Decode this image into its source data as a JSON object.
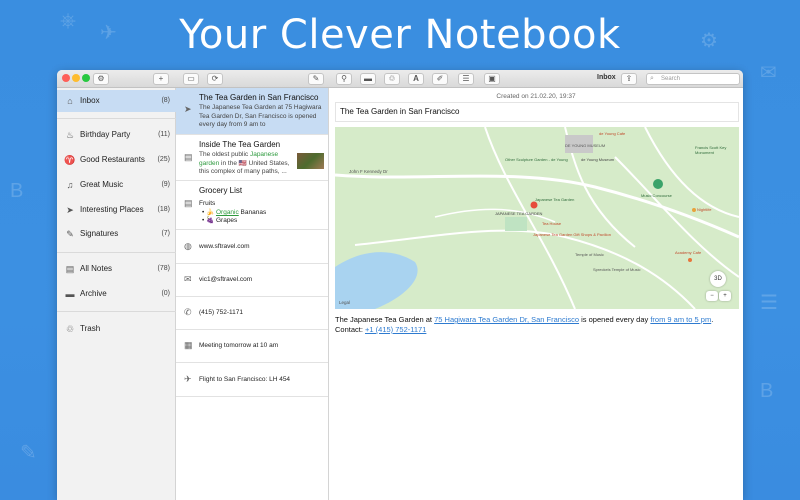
{
  "hero": {
    "title": "Your Clever Notebook"
  },
  "toolbar": {
    "window_title": "Inbox",
    "search_placeholder": "Search",
    "add_label": "+",
    "settings_icon": "gear-icon"
  },
  "sidebar": {
    "items": [
      {
        "label": "Inbox",
        "count": "(8)",
        "icon": "inbox-icon",
        "glyph": "⌂"
      },
      {
        "label": "Birthday Party",
        "count": "(11)",
        "icon": "cake-icon",
        "glyph": "♨"
      },
      {
        "label": "Good Restaurants",
        "count": "(25)",
        "icon": "fork-knife-icon",
        "glyph": "♈"
      },
      {
        "label": "Great Music",
        "count": "(9)",
        "icon": "music-note-icon",
        "glyph": "♫"
      },
      {
        "label": "Interesting Places",
        "count": "(18)",
        "icon": "location-arrow-icon",
        "glyph": "➤"
      },
      {
        "label": "Signatures",
        "count": "(7)",
        "icon": "pen-icon",
        "glyph": "✎"
      },
      {
        "label": "All Notes",
        "count": "(78)",
        "icon": "document-icon",
        "glyph": "▤"
      },
      {
        "label": "Archive",
        "count": "(0)",
        "icon": "archive-box-icon",
        "glyph": "▬"
      },
      {
        "label": "Trash",
        "count": "",
        "icon": "trash-icon",
        "glyph": "♲"
      }
    ]
  },
  "notes": {
    "n1": {
      "title": "The Tea Garden in San Francisco",
      "preview": "The Japanese Tea Garden at 75 Hagiwara Tea Garden Dr, San Francisco is opened every day from 9 am to"
    },
    "n2": {
      "title": "Inside The Tea Garden",
      "preview_a": "The oldest public ",
      "preview_hl": "Japanese garden",
      "preview_b": " in the 🇺🇸 United States, this complex of many paths, ..."
    },
    "n3": {
      "title": "Grocery List",
      "line1": "Fruits",
      "line2_prefix": "• 🍌 ",
      "line2_hl": "Organic",
      "line2_rest": " Bananas",
      "line3": "• 🍇 Grapes"
    },
    "n4": {
      "text": "www.sftravel.com"
    },
    "n5": {
      "text": "vic1@sftravel.com"
    },
    "n6": {
      "text": "(415) 752-1171"
    },
    "n7": {
      "text": "Meeting tomorrow at 10 am"
    },
    "n8": {
      "text": "Flight to San Francisco: LH 454"
    }
  },
  "editor": {
    "created": "Created on 21.02.20, 19:37",
    "title": "The Tea Garden in San Francisco",
    "body_1": "The Japanese Tea Garden at ",
    "link_address": "75 Hagiwara Tea Garden Dr, San Francisco",
    "body_2": " is opened every day ",
    "link_hours": "from 9 am to 5 pm",
    "body_3": ". Contact: ",
    "link_phone": "+1 (415) 752-1171"
  },
  "map": {
    "labels": {
      "young_cafe": "de Young Cafe",
      "de_young": "DE YOUNG MUSEUM",
      "young_museum": "de Young Museum",
      "sculpture": "Other Sculpture Garden - de Young",
      "tea_garden": "JAPANESE TEA GARDEN",
      "tea_garden2": "Japanese Tea Garden",
      "tea_house": "Tea House",
      "temple": "Temple of Music",
      "shops": "Japanese Tea Garden Gift Shops & Pavilion",
      "bandshell": "Spreckels Temple of Music",
      "concourse": "Music Concourse",
      "francis_scott": "Francis Scott Key Monument",
      "nightlife": "Nightlife",
      "academy": "Academy Cafe",
      "john_kennedy": "John F Kennedy Dr",
      "legal": "Legal"
    },
    "controls": {
      "three_d": "3D",
      "zoom_in": "+",
      "zoom_out": "−"
    }
  },
  "colors": {
    "background": "#3a8ee0",
    "selection": "#c7dcf3",
    "link": "#2e7bd0",
    "map_green": "#d6ebc9",
    "map_water": "#a9d3f0"
  }
}
